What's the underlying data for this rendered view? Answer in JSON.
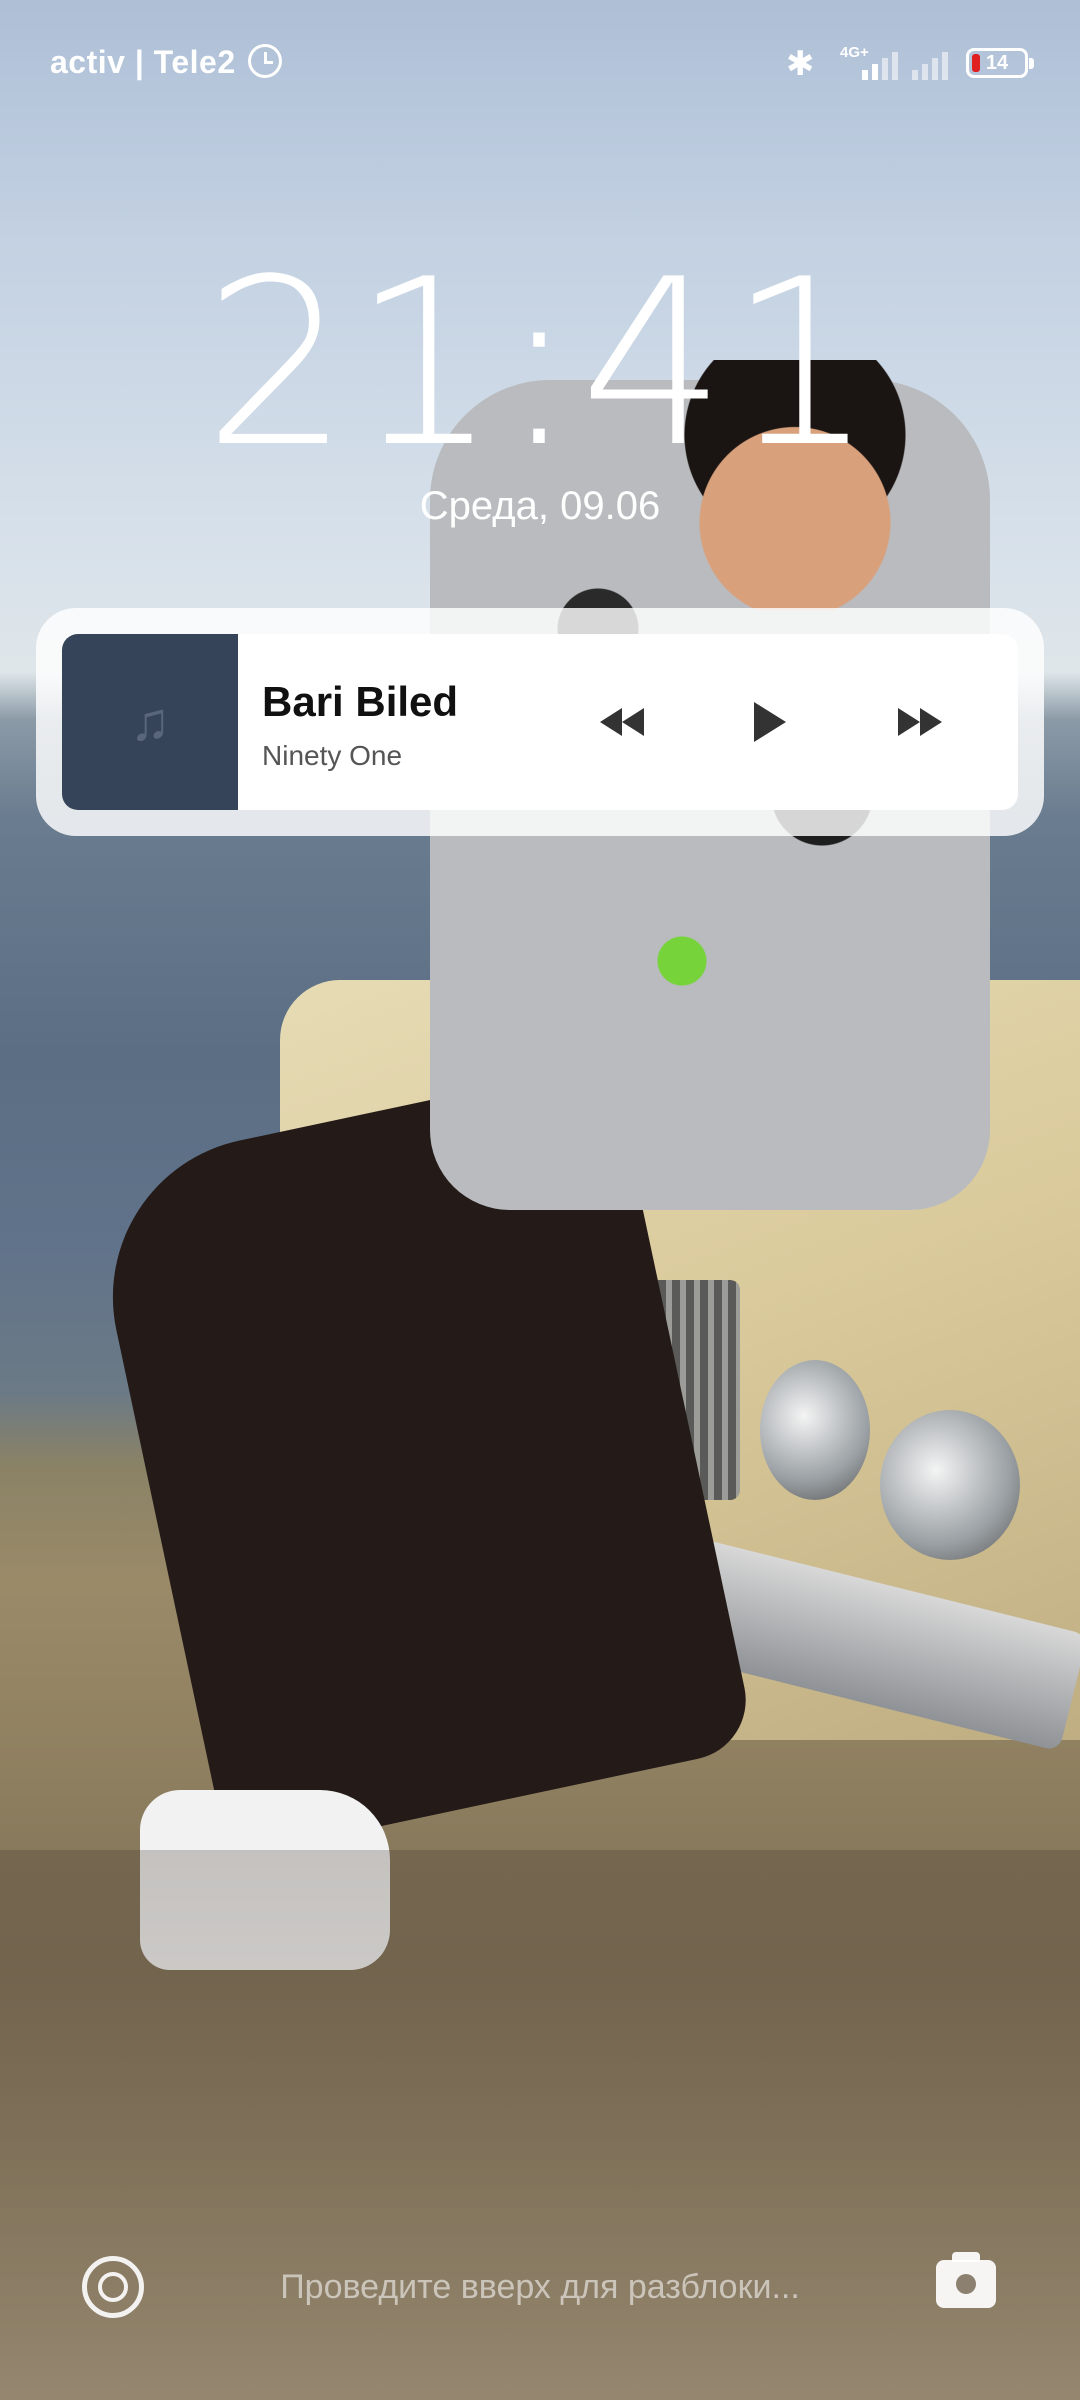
{
  "status_bar": {
    "carrier": "activ | Tele2",
    "alarm_icon": "alarm-clock-icon",
    "bluetooth_icon": "bluetooth-icon",
    "network_type": "4G+",
    "battery_level": "14",
    "battery_color": "#e02020"
  },
  "lockscreen": {
    "time": "21:41",
    "date": "Среда, 09.06",
    "unlock_hint": "Проведите вверх для разблоки...",
    "assistant_icon": "assistant-icon",
    "camera_icon": "camera-icon"
  },
  "music_widget": {
    "track_title": "Bari Biled",
    "artist": "Ninety One",
    "album_art_color": "#364459",
    "note_icon": "music-note-icon",
    "controls": {
      "prev_icon": "previous-track-icon",
      "play_icon": "play-icon",
      "next_icon": "next-track-icon"
    }
  }
}
